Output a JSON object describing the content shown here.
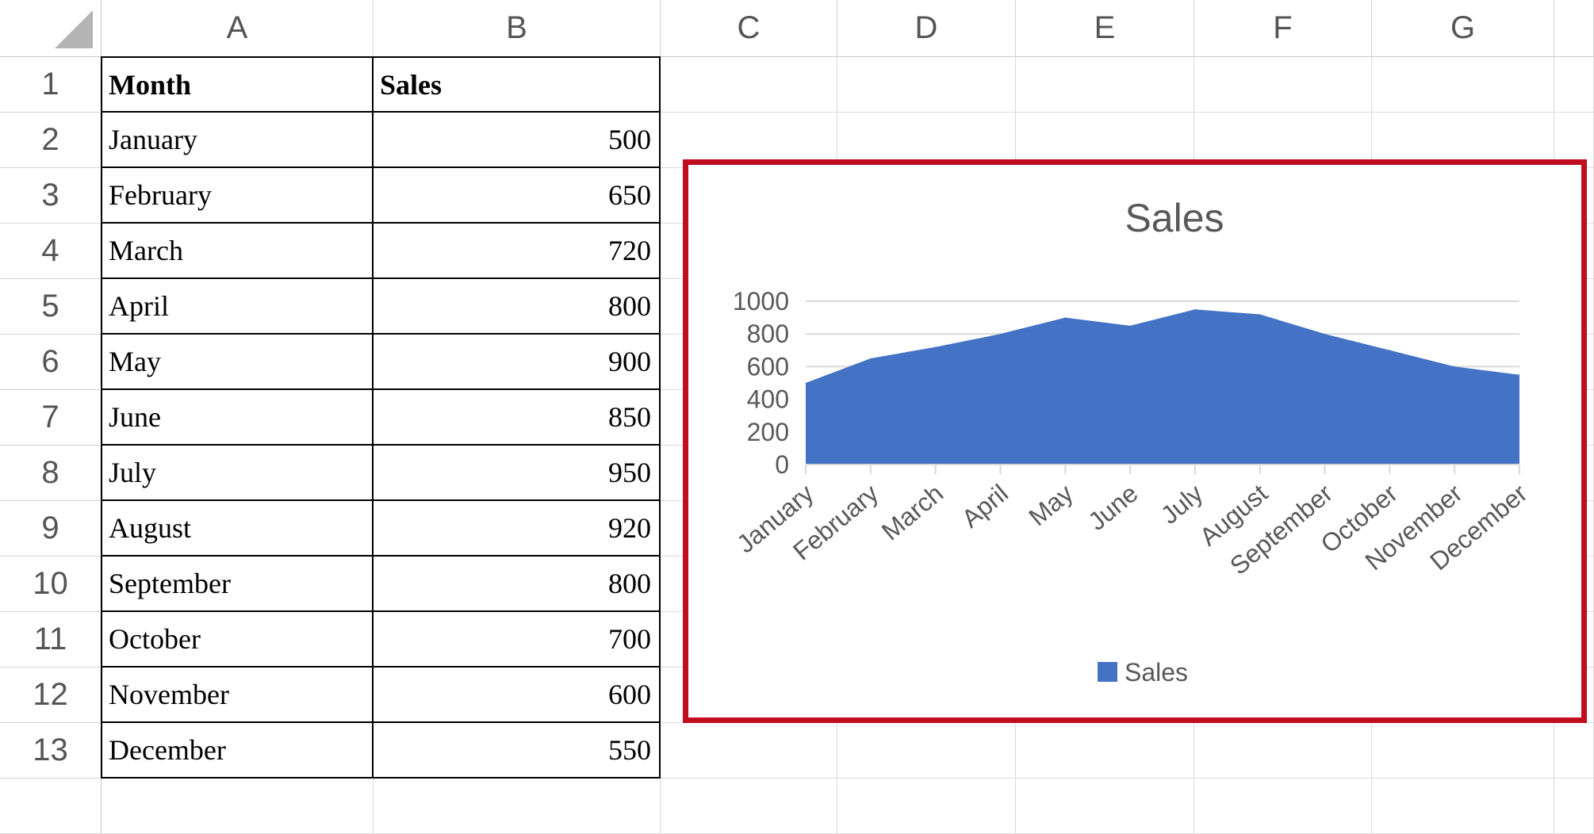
{
  "sheet": {
    "columns": [
      "A",
      "B",
      "C",
      "D",
      "E",
      "F",
      "G"
    ],
    "rows": [
      "1",
      "2",
      "3",
      "4",
      "5",
      "6",
      "7",
      "8",
      "9",
      "10",
      "11",
      "12",
      "13"
    ],
    "table": {
      "headers": [
        "Month",
        "Sales"
      ],
      "records": [
        {
          "month": "January",
          "sales": "500"
        },
        {
          "month": "February",
          "sales": "650"
        },
        {
          "month": "March",
          "sales": "720"
        },
        {
          "month": "April",
          "sales": "800"
        },
        {
          "month": "May",
          "sales": "900"
        },
        {
          "month": "June",
          "sales": "850"
        },
        {
          "month": "July",
          "sales": "950"
        },
        {
          "month": "August",
          "sales": "920"
        },
        {
          "month": "September",
          "sales": "800"
        },
        {
          "month": "October",
          "sales": "700"
        },
        {
          "month": "November",
          "sales": "600"
        },
        {
          "month": "December",
          "sales": "550"
        }
      ]
    }
  },
  "colors": {
    "highlight_border": "#c00d20",
    "area_fill": "#4472c4",
    "gridline": "#d9d9d9",
    "axis_text": "#595959"
  },
  "chart_data": {
    "type": "area",
    "title": "Sales",
    "categories": [
      "January",
      "February",
      "March",
      "April",
      "May",
      "June",
      "July",
      "August",
      "September",
      "October",
      "November",
      "December"
    ],
    "series": [
      {
        "name": "Sales",
        "values": [
          500,
          650,
          720,
          800,
          900,
          850,
          950,
          920,
          800,
          700,
          600,
          550
        ]
      }
    ],
    "ylim": [
      0,
      1000
    ],
    "yticks": [
      0,
      200,
      400,
      600,
      800,
      1000
    ],
    "grid": true,
    "legend": "bottom",
    "xlabel": "",
    "ylabel": ""
  }
}
